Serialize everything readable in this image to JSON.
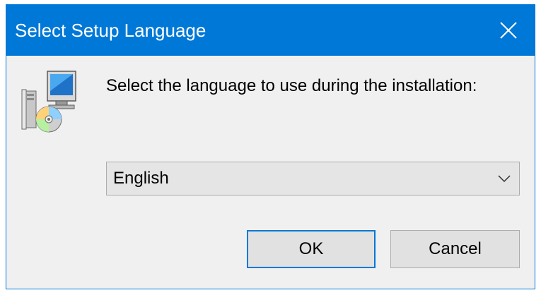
{
  "window": {
    "title": "Select Setup Language",
    "close_icon": "close-icon",
    "accent_color": "#0078d7"
  },
  "dialog": {
    "icon": "setup-computer-cd-icon",
    "prompt": "Select the language to use during the installation:",
    "language_select": {
      "selected": "English",
      "arrow_icon": "chevron-down-icon"
    }
  },
  "buttons": {
    "ok_label": "OK",
    "cancel_label": "Cancel"
  }
}
